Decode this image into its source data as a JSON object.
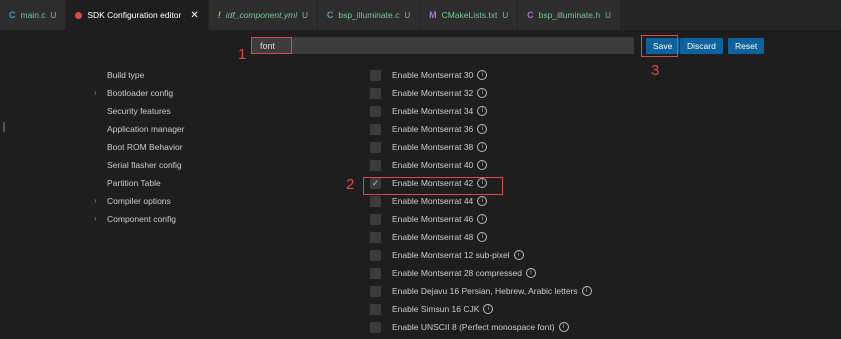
{
  "tabs": [
    {
      "icon": "C",
      "icon_class": "ic-c",
      "label": "main.c",
      "badge": "U"
    },
    {
      "icon": "",
      "label": "SDK Configuration editor",
      "active": true
    },
    {
      "icon": "!",
      "icon_class": "ic-yml",
      "label": "idf_component.yml",
      "badge": "U"
    },
    {
      "icon": "C",
      "icon_class": "ic-c",
      "label": "bsp_illuminate.c",
      "badge": "U"
    },
    {
      "icon": "M",
      "icon_class": "ic-m",
      "label": "CMakeLists.txt",
      "badge": "U"
    },
    {
      "icon": "C",
      "icon_class": "ic-c2",
      "label": "bsp_illuminate.h",
      "badge": "U"
    }
  ],
  "search": {
    "value": "font"
  },
  "buttons": {
    "save": "Save",
    "discard": "Discard",
    "reset": "Reset"
  },
  "markers": {
    "one": "1",
    "two": "2",
    "three": "3"
  },
  "sidebar": {
    "items": [
      {
        "label": "Build type",
        "expandable": false
      },
      {
        "label": "Bootloader config",
        "expandable": true
      },
      {
        "label": "Security features",
        "expandable": false
      },
      {
        "label": "Application manager",
        "expandable": false
      },
      {
        "label": "Boot ROM Behavior",
        "expandable": false
      },
      {
        "label": "Serial flasher config",
        "expandable": false
      },
      {
        "label": "Partition Table",
        "expandable": false
      },
      {
        "label": "Compiler options",
        "expandable": true
      },
      {
        "label": "Component config",
        "expandable": true
      }
    ]
  },
  "options": [
    {
      "label": "Enable Montserrat 30",
      "checked": false
    },
    {
      "label": "Enable Montserrat 32",
      "checked": false
    },
    {
      "label": "Enable Montserrat 34",
      "checked": false
    },
    {
      "label": "Enable Montserrat 36",
      "checked": false
    },
    {
      "label": "Enable Montserrat 38",
      "checked": false
    },
    {
      "label": "Enable Montserrat 40",
      "checked": false
    },
    {
      "label": "Enable Montserrat 42",
      "checked": true
    },
    {
      "label": "Enable Montserrat 44",
      "checked": false
    },
    {
      "label": "Enable Montserrat 46",
      "checked": false
    },
    {
      "label": "Enable Montserrat 48",
      "checked": false
    },
    {
      "label": "Enable Montserrat 12 sub-pixel",
      "checked": false
    },
    {
      "label": "Enable Montserrat 28 compressed",
      "checked": false
    },
    {
      "label": "Enable Dejavu 16 Persian, Hebrew, Arabic letters",
      "checked": false
    },
    {
      "label": "Enable Simsun 16 CJK",
      "checked": false
    },
    {
      "label": "Enable UNSCII 8 (Perfect monospace font)",
      "checked": false
    }
  ],
  "colors": {
    "accent": "#0e639c",
    "annotation": "#e04848",
    "modified": "#73c991"
  }
}
